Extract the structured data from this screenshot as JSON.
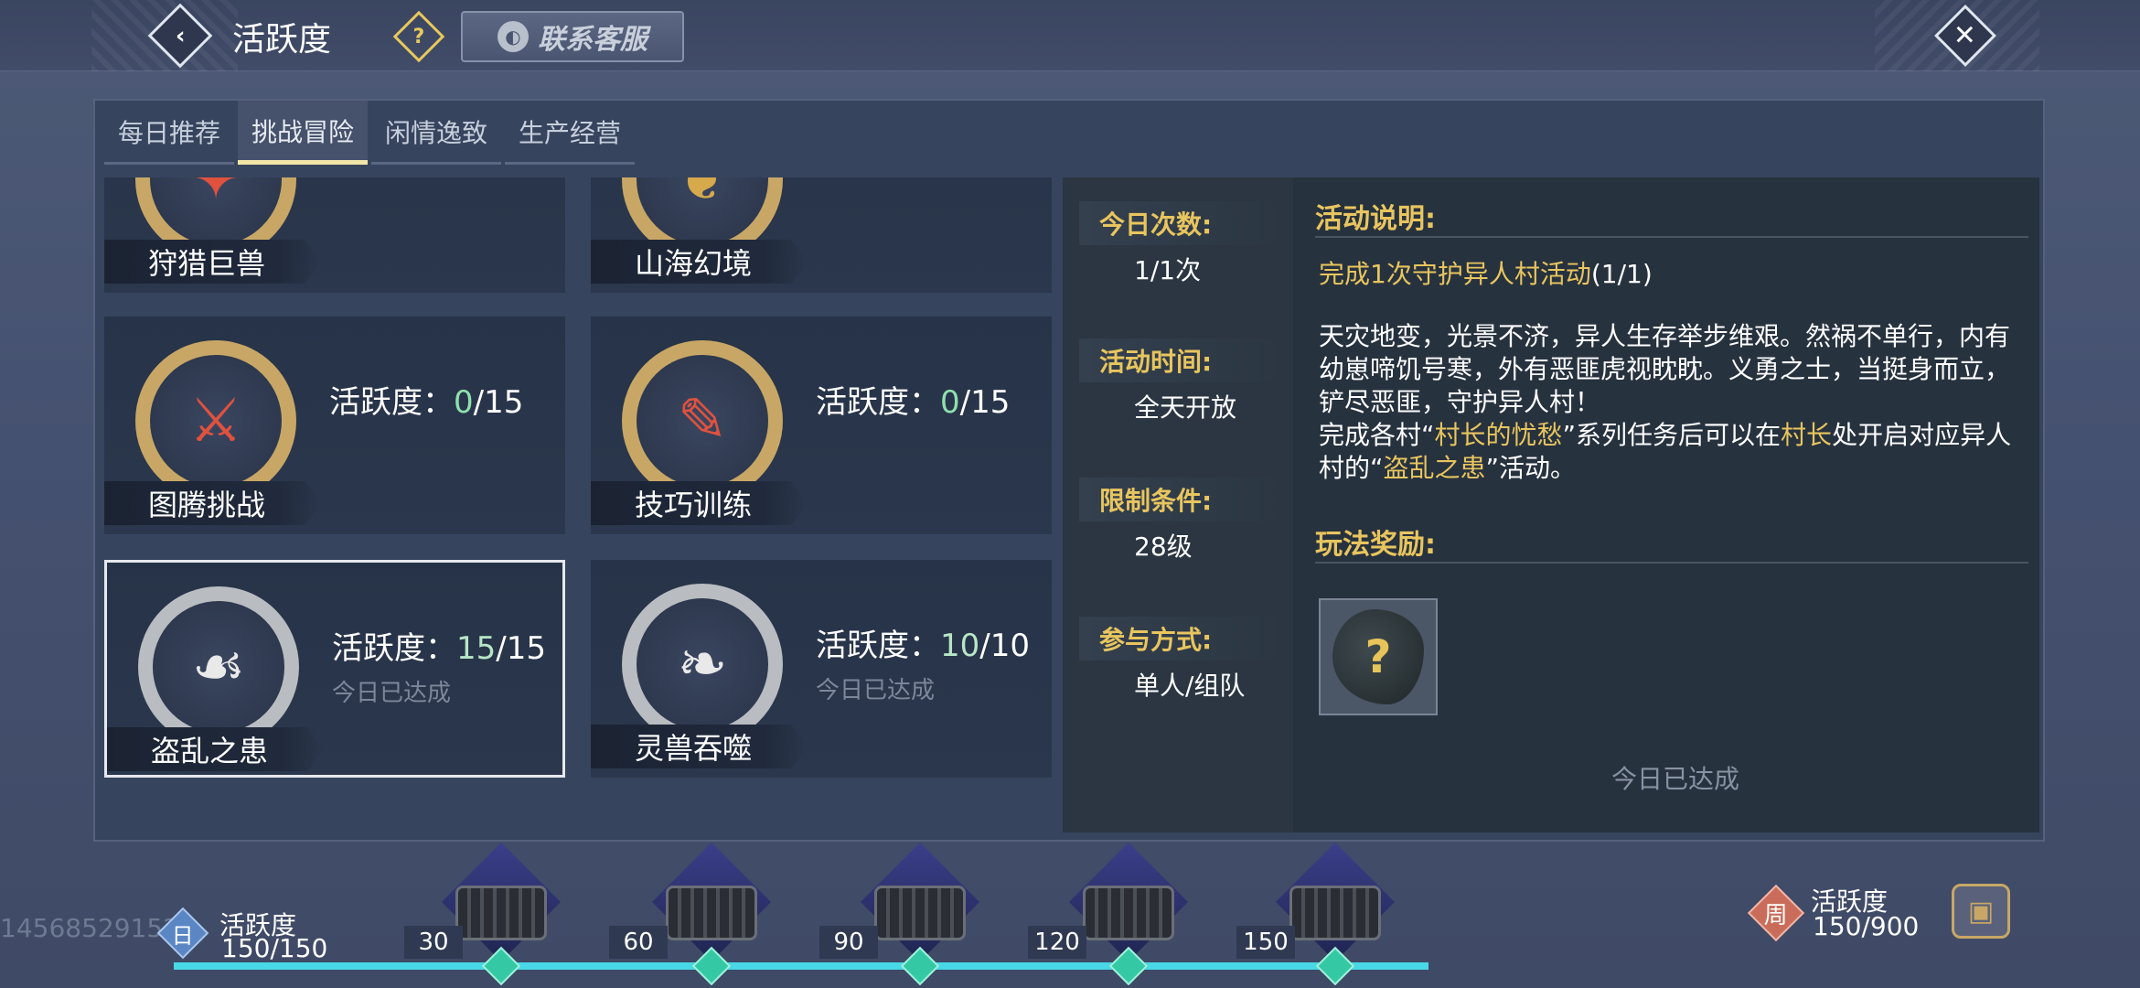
{
  "header": {
    "title": "活跃度",
    "help_icon": "?",
    "service_label": "联系客服",
    "back_icon": "chevron-left-icon",
    "close_icon": "close-icon"
  },
  "tabs": [
    {
      "label": "每日推荐",
      "active": false
    },
    {
      "label": "挑战冒险",
      "active": true
    },
    {
      "label": "闲情逸致",
      "active": false
    },
    {
      "label": "生产经营",
      "active": false
    }
  ],
  "activities": [
    {
      "name": "狩猎巨兽",
      "icon": "beast-hunt-icon"
    },
    {
      "name": "山海幻境",
      "icon": "mythical-realm-icon"
    },
    {
      "name": "图腾挑战",
      "icon": "axe-sword-icon",
      "score_label": "活跃度：",
      "current": "0",
      "max": "/15"
    },
    {
      "name": "技巧训练",
      "icon": "scroll-brush-icon",
      "score_label": "活跃度：",
      "current": "0",
      "max": "/15"
    },
    {
      "name": "盗乱之患",
      "icon": "bandit-icon",
      "score_label": "活跃度：",
      "current": "15",
      "max": "/15",
      "status": "今日已达成"
    },
    {
      "name": "灵兽吞噬",
      "icon": "spirit-beast-icon",
      "score_label": "活跃度：",
      "current": "10",
      "max": "/10",
      "status": "今日已达成"
    }
  ],
  "detail": {
    "info": [
      {
        "label": "今日次数:",
        "value": "1/1次"
      },
      {
        "label": "活动时间:",
        "value": "全天开放"
      },
      {
        "label": "限制条件:",
        "value": "28级"
      },
      {
        "label": "参与方式:",
        "value": "单人/组队"
      }
    ],
    "desc_title": "活动说明:",
    "task_highlight": "完成1次守护异人村活动",
    "task_count": "(1/1)",
    "body_1": "天灾地变，光景不济，异人生存举步维艰。然祸不单行，内有幼崽啼饥号寒，外有恶匪虎视眈眈。义勇之士，当挺身而立，铲尽恶匪，守护异人村！",
    "body_2a": "完成各村“",
    "body_2b": "村长的忧愁",
    "body_2c": "”系列任务后可以在",
    "body_2d": "村长",
    "body_2e": "处开启对应异人村的“",
    "body_2f": "盗乱之患",
    "body_2g": "”活动。",
    "reward_title": "玩法奖励:",
    "reward_icon": "?",
    "reward_status": "今日已达成"
  },
  "progress": {
    "uid": "14568529152",
    "day_badge": "日",
    "day_label": "活跃度",
    "day_value": "150/150",
    "milestones": [
      "30",
      "60",
      "90",
      "120",
      "150"
    ],
    "week_badge": "周",
    "week_label": "活跃度",
    "week_value": "150/900",
    "week_chest_icon": "treasure-chest-icon"
  }
}
